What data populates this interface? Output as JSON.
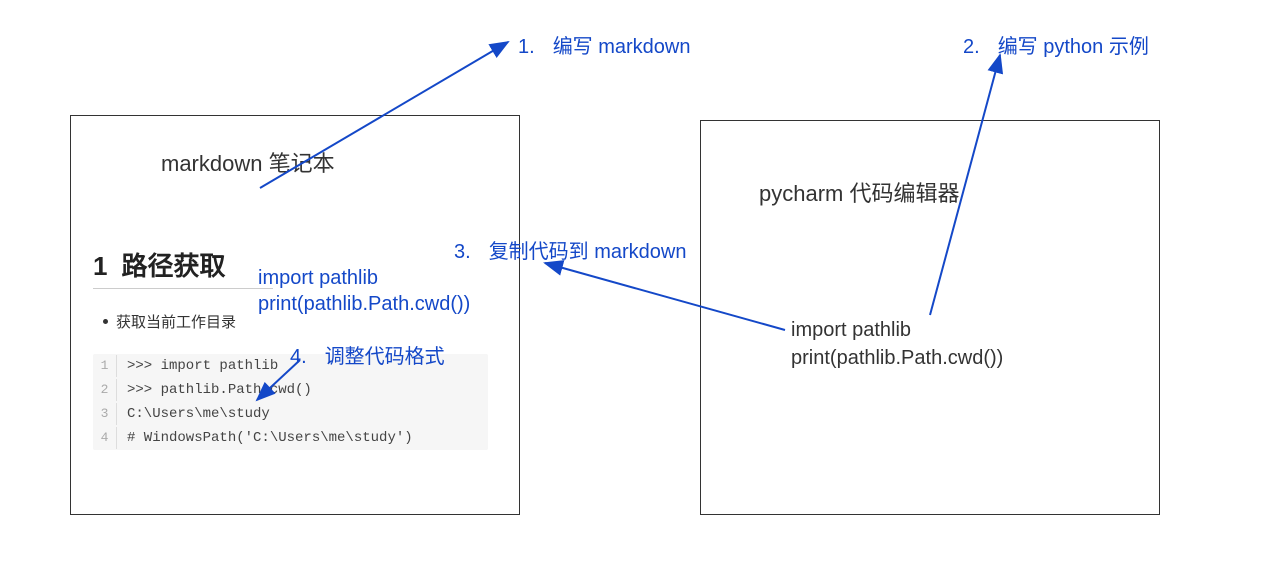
{
  "left_box": {
    "title": "markdown 笔记本",
    "heading_num": "1",
    "heading_text": "路径获取",
    "bullet": "获取当前工作目录",
    "code_lines": [
      ">>> import pathlib",
      ">>> pathlib.Path.cwd()",
      "C:\\Users\\me\\study",
      "# WindowsPath('C:\\Users\\me\\study')"
    ]
  },
  "right_box": {
    "title": "pycharm 代码编辑器",
    "code_lines": [
      "import pathlib",
      "print(pathlib.Path.cwd())"
    ]
  },
  "annotations": {
    "a1": {
      "num": "1.",
      "text": "编写 markdown"
    },
    "a2": {
      "num": "2.",
      "text": "编写 python 示例"
    },
    "a3": {
      "num": "3.",
      "text": "复制代码到 markdown"
    },
    "a4": {
      "num": "4.",
      "text": "调整代码格式"
    },
    "a5_line1": "import pathlib",
    "a5_line2": "print(pathlib.Path.cwd())"
  }
}
